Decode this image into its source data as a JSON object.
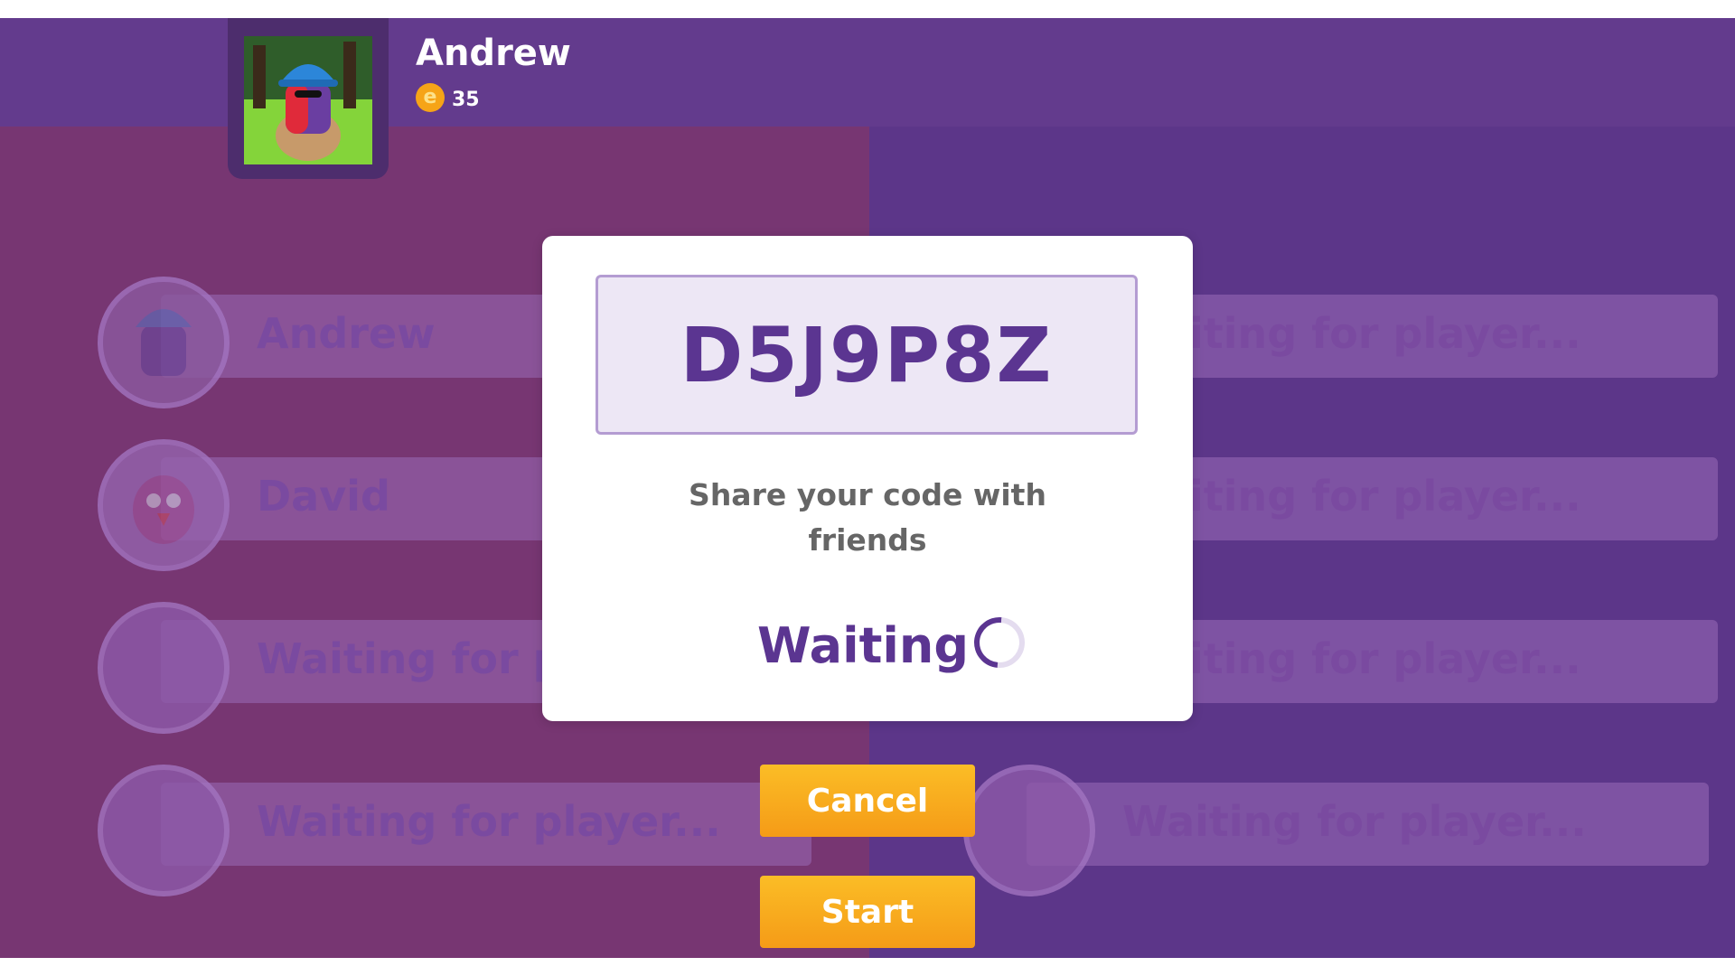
{
  "profile": {
    "name": "Andrew",
    "coin_icon_letter": "e",
    "coins": "35"
  },
  "players_left": [
    {
      "label": "Andrew",
      "avatar": "character-cap-icon"
    },
    {
      "label": "David",
      "avatar": "character-bird-icon"
    },
    {
      "label": "Waiting for pla",
      "avatar": "empty-avatar"
    },
    {
      "label": "Waiting for player...",
      "avatar": "empty-avatar"
    }
  ],
  "players_right": [
    {
      "label": "iting for player..."
    },
    {
      "label": "iting for player..."
    },
    {
      "label": "iting for player..."
    },
    {
      "label": "Waiting for player..."
    }
  ],
  "modal": {
    "code": "D5J9P8Z",
    "share_text": "Share your code with friends",
    "waiting_label": "Waiting"
  },
  "buttons": {
    "cancel": "Cancel",
    "start": "Start"
  },
  "colors": {
    "header": "#633b8d",
    "team_left": "#773672",
    "team_right": "#5c3689",
    "button": "#f9ae1e",
    "code_text": "#5b3591"
  }
}
